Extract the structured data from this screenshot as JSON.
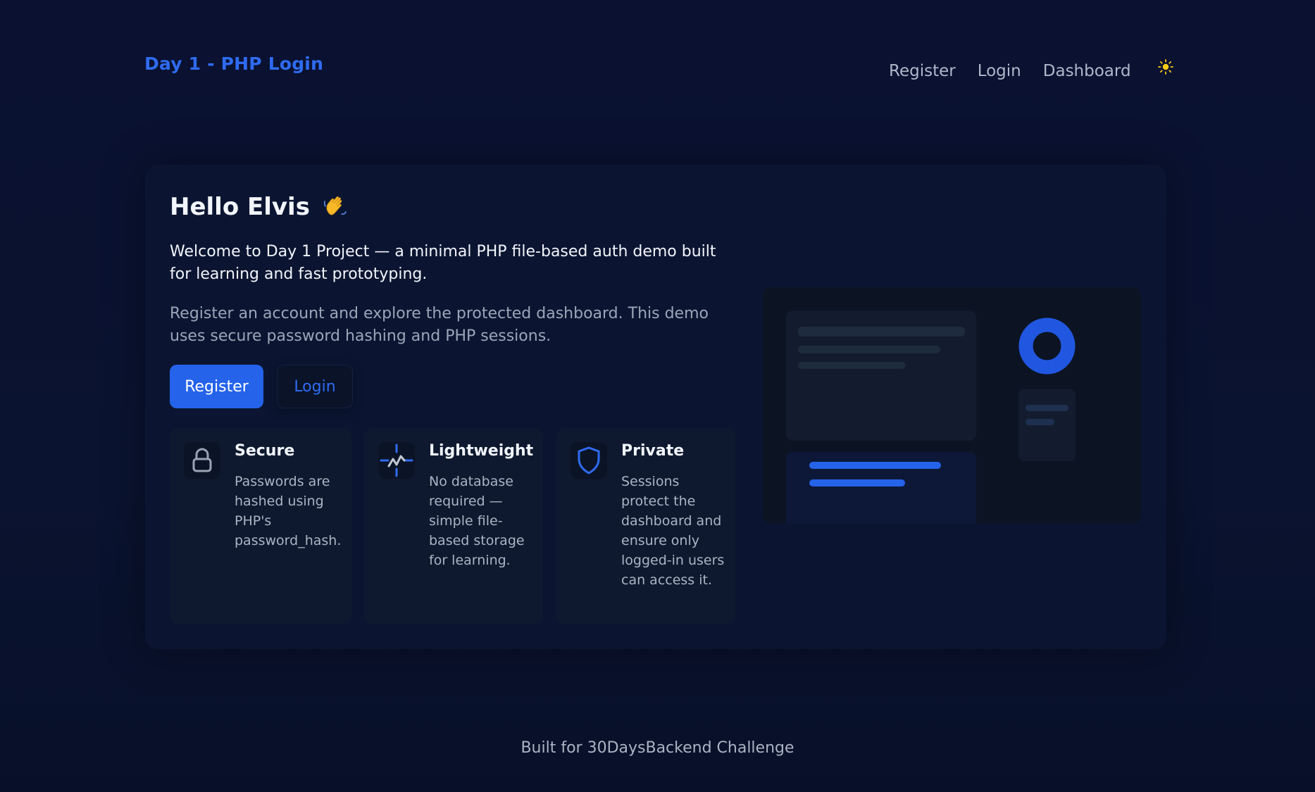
{
  "header": {
    "brand": "Day 1 - PHP Login",
    "nav": [
      "Register",
      "Login",
      "Dashboard"
    ],
    "theme_toggle_icon": "sun-icon"
  },
  "hero": {
    "greeting": "Hello Elvis",
    "greeting_icon": "waving-hand-icon",
    "lead": "Welcome to Day 1 Project — a minimal PHP file-based auth demo built for learning and fast prototyping.",
    "sub": "Register an account and explore the protected dashboard. This demo uses secure password hashing and PHP sessions.",
    "register_label": "Register",
    "login_label": "Login"
  },
  "features": [
    {
      "icon": "lock-icon",
      "title": "Secure",
      "desc": "Passwords are hashed using PHP's password_hash."
    },
    {
      "icon": "activity-icon",
      "title": "Lightweight",
      "desc": "No database required — simple file-based storage for learning."
    },
    {
      "icon": "shield-icon",
      "title": "Private",
      "desc": "Sessions protect the dashboard and ensure only logged-in users can access it."
    }
  ],
  "footer": "Built for 30DaysBackend Challenge",
  "colors": {
    "accent": "#2563eb",
    "brand": "#2f6bf0",
    "background": "#0a1131",
    "card": "#0b1531",
    "sun": "#facc15"
  }
}
